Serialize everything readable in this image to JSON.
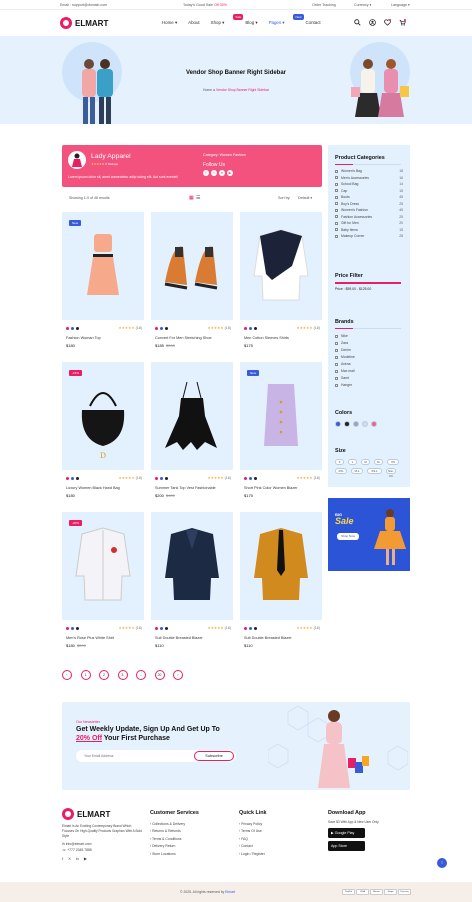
{
  "topbar": {
    "email": "Email : support@domain.com",
    "sale_prefix": "Today's Good Sale",
    "sale_value": "Off 30%",
    "order_tracking": "Order Tracking",
    "currency": "Currency",
    "language": "Language"
  },
  "header": {
    "logo_text": "ELMART",
    "nav": [
      {
        "label": "Home"
      },
      {
        "label": "About"
      },
      {
        "label": "Shop",
        "badge": "Sale"
      },
      {
        "label": "Blog"
      },
      {
        "label": "Pages",
        "badge": "New"
      },
      {
        "label": "Contact"
      }
    ],
    "cart_count": "0",
    "wish_count": "0"
  },
  "banner": {
    "title": "Vendor Shop Banner Right Sidebar",
    "crumb_home": "Home",
    "crumb_current": "Vendor Shop Banner Right Sidebar"
  },
  "vendor": {
    "name": "Lady Apparel",
    "rating_count": "0 Ratings",
    "category_label": "Category:",
    "category_value": "Women Fashion",
    "follow_label": "Follow Us",
    "description": "Lorem ipsum dolor sit, amet consectetur adipi sicing elit. Aut sunt eveniet!"
  },
  "sortbar": {
    "results": "Showing 1-9 of 46 results",
    "sort_label": "Sort by:",
    "sort_value": "Default"
  },
  "products": [
    {
      "name": "Fashion Woman Top",
      "price": "$180",
      "old": "",
      "rating": "(18)",
      "tag": "New",
      "tag_color": "#3a5bd9"
    },
    {
      "name": "Convert For Men Stretching Shoe",
      "price": "$185",
      "old": "$200",
      "rating": "(18)",
      "tag": "",
      "tag_color": ""
    },
    {
      "name": "Men Cotton Sleeves Shirts",
      "price": "$175",
      "old": "",
      "rating": "(18)",
      "tag": "",
      "tag_color": ""
    },
    {
      "name": "Luxury Women Black Hand Bag",
      "price": "$180",
      "old": "",
      "rating": "(18)",
      "tag": "-15%",
      "tag_color": "#e91e63"
    },
    {
      "name": "Summer Tank Top Vest Fashionable",
      "price": "$200",
      "old": "$400",
      "rating": "(18)",
      "tag": "",
      "tag_color": ""
    },
    {
      "name": "Short Pink Color Women Blazer",
      "price": "$175",
      "old": "",
      "rating": "(18)",
      "tag": "New",
      "tag_color": "#3a5bd9"
    },
    {
      "name": "Men's Rose Plus White Shirt",
      "price": "$180",
      "old": "$200",
      "rating": "(18)",
      "tag": "-20%",
      "tag_color": "#e91e63"
    },
    {
      "name": "Suit Double Breasted Blazer",
      "price": "$110",
      "old": "",
      "rating": "(18)",
      "tag": "",
      "tag_color": ""
    },
    {
      "name": "Suit Double Breasted Blazer",
      "price": "$110",
      "old": "",
      "rating": "(18)",
      "tag": "",
      "tag_color": ""
    }
  ],
  "sidebar": {
    "categories_title": "Product Categories",
    "categories": [
      {
        "label": "Women's Bag",
        "count": "18"
      },
      {
        "label": "Men's Accessories",
        "count": "16"
      },
      {
        "label": "School Bag",
        "count": "14"
      },
      {
        "label": "Cap",
        "count": "15"
      },
      {
        "label": "Boots",
        "count": "45"
      },
      {
        "label": "Boy's Dress",
        "count": "25"
      },
      {
        "label": "Women's Fashion",
        "count": "45"
      },
      {
        "label": "Fashion Accessories",
        "count": "25"
      },
      {
        "label": "Gift for Men",
        "count": "20"
      },
      {
        "label": "Baby Items",
        "count": "15"
      },
      {
        "label": "Makeup Corner",
        "count": "28"
      }
    ],
    "price_title": "Price Filter",
    "price_label": "Price :",
    "price_range": "$59.00 - $125.00",
    "brands_title": "Brands",
    "brands": [
      "Nike",
      "Zara",
      "Denim",
      "Modeline",
      "Avena",
      "Max mall",
      "Samt",
      "Hanger"
    ],
    "colors_title": "Colors",
    "colors": [
      "#3a5bd9",
      "#222222",
      "#9aa3b4",
      "#d4dbe6",
      "#f15f8a"
    ],
    "size_title": "Size",
    "sizes": [
      "S",
      "L",
      "M",
      "XL",
      "XS",
      "XXL",
      "M-L",
      "XS-L",
      "Non-Fit",
      "XL"
    ],
    "promo_label": "BIG",
    "promo_sale": "Sale",
    "promo_button": "Shop Now"
  },
  "pagination": [
    "‹",
    "1",
    "2",
    "3",
    "...",
    "20",
    "›"
  ],
  "newsletter": {
    "eyebrow": "Our Newsletter",
    "headline_1": "Get Weekly Update, Sign Up And Get Up To",
    "highlight": "20% Off",
    "headline_2": "Your First Purchase",
    "placeholder": "Your Email Address",
    "button": "Subscribe"
  },
  "footer": {
    "logo_text": "ELMART",
    "about": "Elmart Is An Exciting Contemporary Brand Which Focuses On High-Quality Products Graphics With A Bold Style",
    "email": "info@elmart.com",
    "phone": "+777 2345 7885",
    "customer_title": "Customer Services",
    "customer_links": [
      "Collections & Delivery",
      "Returns & Refunds",
      "Terms & Conditions",
      "Delivery Return",
      "Store Locations"
    ],
    "quick_title": "Quick Link",
    "quick_links": [
      "Privacy Policy",
      "Terms Of Use",
      "FAQ",
      "Contact",
      "Login / Register"
    ],
    "app_title": "Download App",
    "app_text": "Save $3 With App & New User Only",
    "google_play": "Google Play",
    "app_store": "App Store",
    "copyright": "© 2025. All rights reserved by",
    "copyright_brand": "Elmart",
    "payments": [
      "PayPal",
      "VISA",
      "Master",
      "Stripe",
      "Discover"
    ]
  }
}
